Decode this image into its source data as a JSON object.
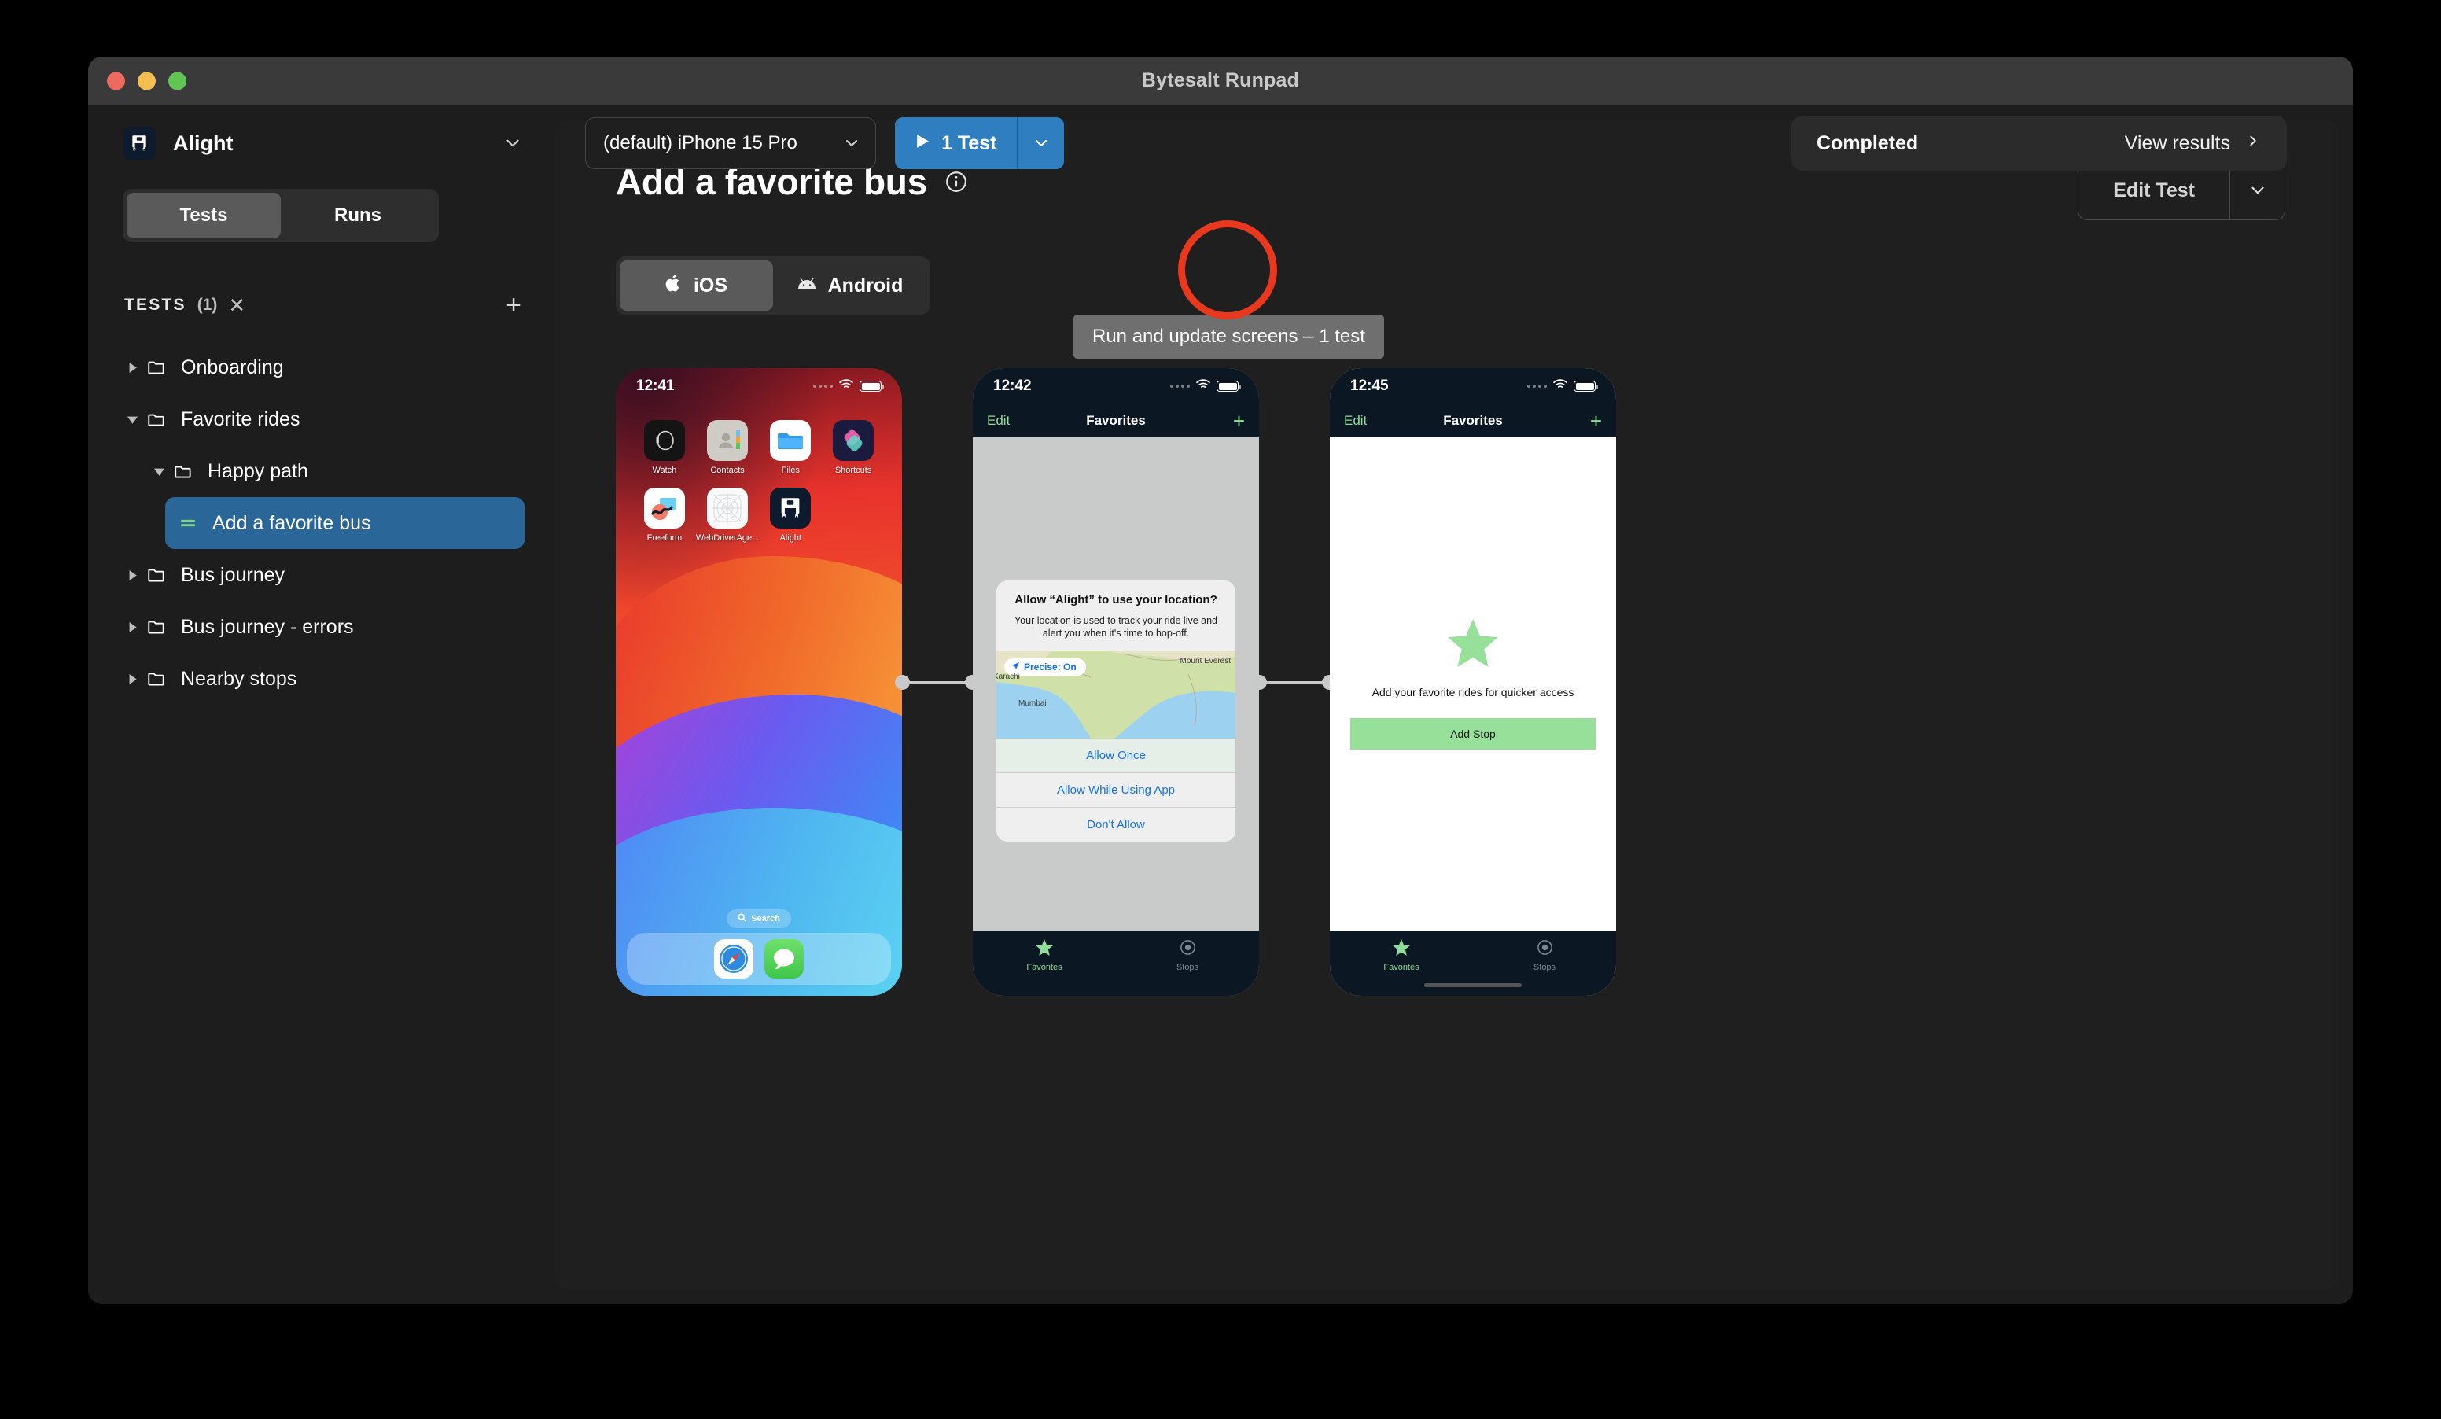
{
  "window": {
    "title": "Bytesalt Runpad"
  },
  "sidebar": {
    "app_name": "Alight",
    "app_icon": "bus-app-icon",
    "chevron_icon": "chevron-down-icon",
    "segments": [
      {
        "label": "Tests",
        "active": true
      },
      {
        "label": "Runs",
        "active": false
      }
    ],
    "tests_header": {
      "label": "TESTS",
      "count": "(1)",
      "close_icon": "close-icon",
      "add_icon": "plus-icon"
    },
    "tree": [
      {
        "label": "Onboarding",
        "type": "folder",
        "expanded": false,
        "indent": 0,
        "selected": false
      },
      {
        "label": "Favorite rides",
        "type": "folder-open",
        "expanded": true,
        "indent": 0,
        "selected": false
      },
      {
        "label": "Happy path",
        "type": "folder-open",
        "expanded": true,
        "indent": 1,
        "selected": false
      },
      {
        "label": "Add a favorite bus",
        "type": "test",
        "expanded": null,
        "indent": 2,
        "selected": true
      },
      {
        "label": "Bus journey",
        "type": "folder",
        "expanded": false,
        "indent": 0,
        "selected": false
      },
      {
        "label": "Bus journey - errors",
        "type": "folder",
        "expanded": false,
        "indent": 0,
        "selected": false
      },
      {
        "label": "Nearby stops",
        "type": "folder",
        "expanded": false,
        "indent": 0,
        "selected": false
      }
    ]
  },
  "toolbar": {
    "device": "(default) iPhone 15 Pro",
    "device_chevron_icon": "chevron-down-icon",
    "run_label": "1 Test",
    "run_play_icon": "play-icon",
    "run_caret_icon": "chevron-down-icon",
    "run_accent_color": "#2f7fc0",
    "tooltip": "Run and update screens – 1 test",
    "highlight_color": "#e8381e",
    "status": "Completed",
    "view_results": "View results",
    "view_results_icon": "chevron-right-icon"
  },
  "main": {
    "title": "Add a favorite bus",
    "info_icon": "info-icon",
    "edit_button": "Edit Test",
    "edit_caret_icon": "chevron-down-icon",
    "platforms": [
      {
        "label": "iOS",
        "icon": "apple-icon",
        "active": true
      },
      {
        "label": "Android",
        "icon": "android-icon",
        "active": false
      }
    ]
  },
  "flow": {
    "phones": [
      {
        "id": "home-screen",
        "status_time": "12:41",
        "apps_row1": [
          {
            "label": "Watch",
            "icon": "watch-app-icon"
          },
          {
            "label": "Contacts",
            "icon": "contacts-app-icon"
          },
          {
            "label": "Files",
            "icon": "files-app-icon"
          },
          {
            "label": "Shortcuts",
            "icon": "shortcuts-app-icon"
          }
        ],
        "apps_row2": [
          {
            "label": "Freeform",
            "icon": "freeform-app-icon"
          },
          {
            "label": "WebDriverAge...",
            "icon": "webdriveragent-app-icon"
          },
          {
            "label": "Alight",
            "icon": "alight-app-icon"
          }
        ],
        "search_label": "Search",
        "search_icon": "search-icon",
        "dock": [
          {
            "label": "Safari",
            "icon": "safari-app-icon"
          },
          {
            "label": "Messages",
            "icon": "messages-app-icon"
          }
        ]
      },
      {
        "id": "location-permission",
        "status_time": "12:42",
        "nav": {
          "left": "Edit",
          "title": "Favorites",
          "right_icon": "plus-icon"
        },
        "alert": {
          "title": "Allow “Alight” to use your location?",
          "message": "Your location is used to track your ride live and alert you when it's time to hop-off.",
          "precise_badge": "Precise: On",
          "precise_icon": "location-arrow-icon",
          "map_labels": [
            "Karachi",
            "Mumbai",
            "Mount Everest"
          ],
          "buttons": [
            "Allow Once",
            "Allow While Using App",
            "Don't Allow"
          ]
        },
        "tabs": [
          {
            "label": "Favorites",
            "icon": "star-icon",
            "active": true
          },
          {
            "label": "Stops",
            "icon": "stop-circle-icon",
            "active": false
          }
        ]
      },
      {
        "id": "favorites-empty",
        "status_time": "12:45",
        "nav": {
          "left": "Edit",
          "title": "Favorites",
          "right_icon": "plus-icon"
        },
        "empty": {
          "icon": "star-icon",
          "message": "Add your favorite rides for quicker access",
          "button": "Add Stop",
          "button_color": "#96e09a"
        },
        "tabs": [
          {
            "label": "Favorites",
            "icon": "star-icon",
            "active": true
          },
          {
            "label": "Stops",
            "icon": "stop-circle-icon",
            "active": false
          }
        ]
      }
    ]
  }
}
